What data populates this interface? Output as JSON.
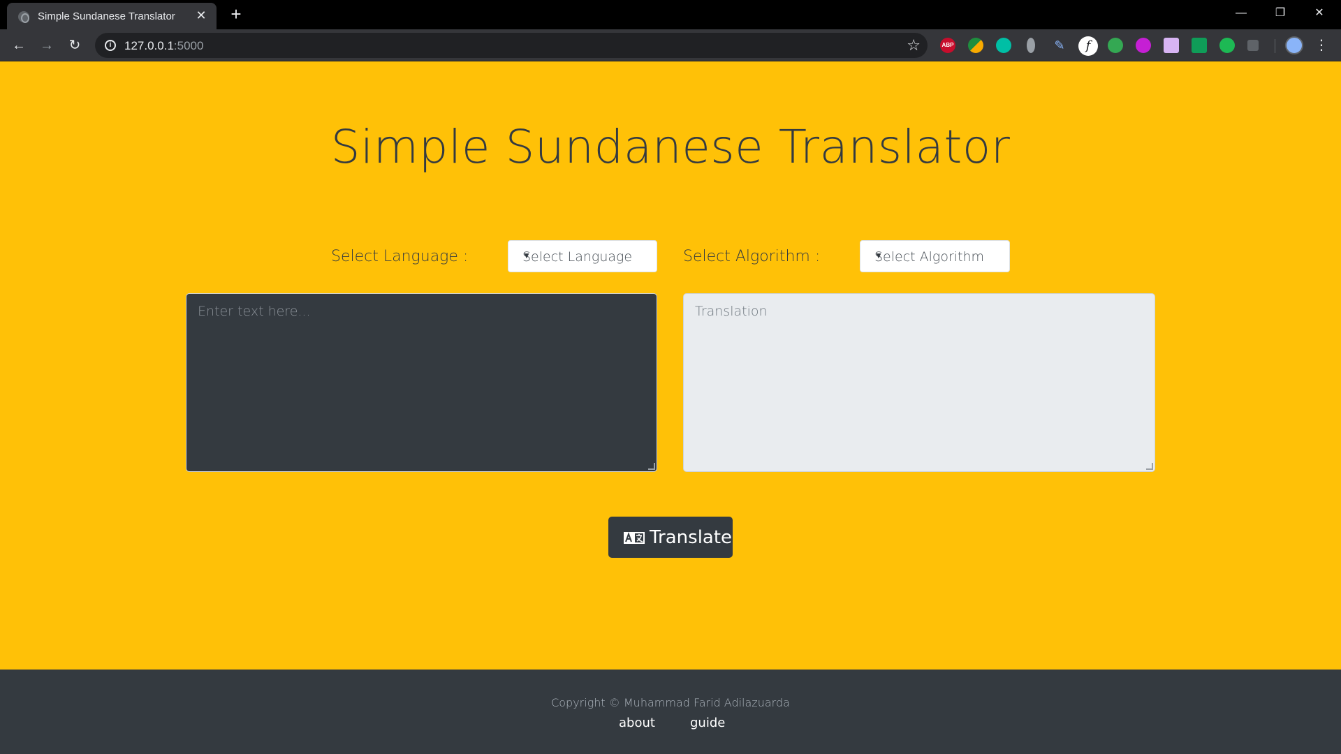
{
  "browser": {
    "tab_title": "Simple Sundanese Translator",
    "url_host": "127.0.0.1",
    "url_port": ":5000",
    "extensions": [
      "ABP"
    ]
  },
  "page": {
    "title": "Simple Sundanese Translator",
    "language_label": "Select Language :",
    "language_select": "Select Language",
    "algorithm_label": "Select Algorithm :",
    "algorithm_select": "Select Algorithm",
    "source_placeholder": "Enter text here...",
    "target_placeholder": "Translation",
    "translate_button": "Translate"
  },
  "footer": {
    "copyright": "Copyright © Muhammad Farid Adilazuarda",
    "links": [
      "about",
      "guide"
    ]
  },
  "colors": {
    "page_background": "#ffc107",
    "dark": "#343a40",
    "translation_background": "#e9ecef"
  }
}
